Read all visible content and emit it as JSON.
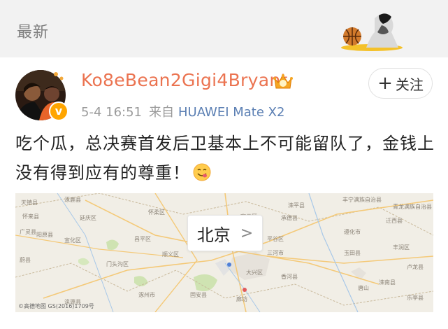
{
  "section": {
    "title": "最新"
  },
  "post": {
    "username": "Ko8eBean2Gigi4Bryant",
    "date": "5-4 16:51",
    "from_label": "来自",
    "source": "HUAWEI Mate X2",
    "follow_label": "关注",
    "text": "吃个瓜，总决赛首发后卫基本上不可能留队了，金钱上没有得到应有的尊重！"
  },
  "map": {
    "city": "北京",
    "credit": "©高德地图 GS(2016)1709号",
    "towns": [
      "天镇县",
      "涿鹿县",
      "怀来县",
      "延庆区",
      "丰宁满族自治县",
      "滦平县",
      "承德县",
      "怀柔区",
      "密云区",
      "平谷区",
      "遵化市",
      "迁西县",
      "青龙满族自治县",
      "广灵县",
      "阳原县",
      "宣化区",
      "昌平区",
      "顺义区",
      "三河市",
      "玉田县",
      "丰润区",
      "卢龙县",
      "蔚县",
      "门头沟区",
      "大兴区",
      "香河县",
      "唐山",
      "涞源县",
      "涿州市",
      "固安县",
      "廊坊",
      "滦南县",
      "乐亭县"
    ]
  },
  "icons": {
    "header_art": "basketball-player-icon",
    "vip": "crown-badge-icon",
    "verified": "verified-badge-icon",
    "emoji": "yummy-face-emoji-icon"
  },
  "colors": {
    "username": "#eb7350",
    "source": "#5b7fb3",
    "verified": "#ffa500"
  }
}
